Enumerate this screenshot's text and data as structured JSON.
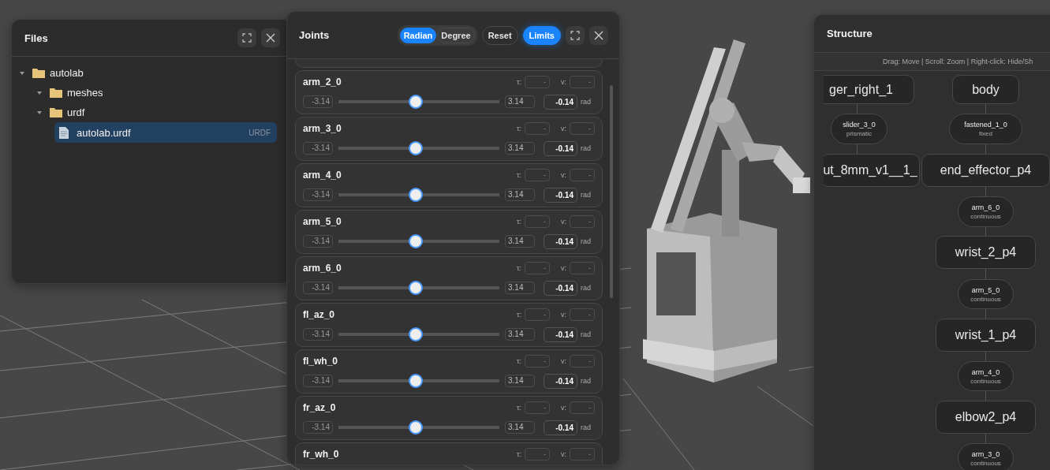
{
  "files_panel": {
    "title": "Files",
    "tree": [
      {
        "name": "autolab",
        "kind": "folder",
        "expanded": true,
        "selected": false,
        "children": [
          {
            "name": "meshes",
            "kind": "folder",
            "expanded": true,
            "selected": false
          },
          {
            "name": "urdf",
            "kind": "folder",
            "expanded": true,
            "selected": false,
            "children": [
              {
                "name": "autolab.urdf",
                "kind": "file",
                "badge": "URDF",
                "selected": true
              }
            ]
          }
        ]
      }
    ]
  },
  "joints_panel": {
    "title": "Joints",
    "units": [
      {
        "label": "Radian",
        "selected": true
      },
      {
        "label": "Degree",
        "selected": false
      }
    ],
    "buttons": [
      {
        "label": "Reset",
        "active": false
      },
      {
        "label": "Limits",
        "active": true
      }
    ],
    "joints": [
      {
        "name": "arm_2_0",
        "tau_label": "τ:",
        "tau": "-",
        "v_label": "v:",
        "v": "-",
        "min": "-3.14",
        "max": "3.14",
        "value": "-0.14",
        "unit": "rad",
        "level": 0.48
      },
      {
        "name": "arm_3_0",
        "tau_label": "τ:",
        "tau": "-",
        "v_label": "v:",
        "v": "-",
        "min": "-3.14",
        "max": "3.14",
        "value": "-0.14",
        "unit": "rad",
        "level": 0.48
      },
      {
        "name": "arm_4_0",
        "tau_label": "τ:",
        "tau": "-",
        "v_label": "v:",
        "v": "-",
        "min": "-3.14",
        "max": "3.14",
        "value": "-0.14",
        "unit": "rad",
        "level": 0.48
      },
      {
        "name": "arm_5_0",
        "tau_label": "τ:",
        "tau": "-",
        "v_label": "v:",
        "v": "-",
        "min": "-3.14",
        "max": "3.14",
        "value": "-0.14",
        "unit": "rad",
        "level": 0.48
      },
      {
        "name": "arm_6_0",
        "tau_label": "τ:",
        "tau": "-",
        "v_label": "v:",
        "v": "-",
        "min": "-3.14",
        "max": "3.14",
        "value": "-0.14",
        "unit": "rad",
        "level": 0.48
      },
      {
        "name": "fl_az_0",
        "tau_label": "τ:",
        "tau": "-",
        "v_label": "v:",
        "v": "-",
        "min": "-3.14",
        "max": "3.14",
        "value": "-0.14",
        "unit": "rad",
        "level": 0.48
      },
      {
        "name": "fl_wh_0",
        "tau_label": "τ:",
        "tau": "-",
        "v_label": "v:",
        "v": "-",
        "min": "-3.14",
        "max": "3.14",
        "value": "-0.14",
        "unit": "rad",
        "level": 0.48
      },
      {
        "name": "fr_az_0",
        "tau_label": "τ:",
        "tau": "-",
        "v_label": "v:",
        "v": "-",
        "min": "-3.14",
        "max": "3.14",
        "value": "-0.14",
        "unit": "rad",
        "level": 0.48
      },
      {
        "name": "fr_wh_0",
        "tau_label": "τ:",
        "tau": "-",
        "v_label": "v:",
        "v": "-"
      }
    ]
  },
  "structure_panel": {
    "title": "Structure",
    "hint": "Drag: Move | Scroll: Zoom | Right-click: Hide/Sh",
    "nodes": [
      {
        "kind": "link",
        "label": "ger_right_1"
      },
      {
        "kind": "link",
        "label": "body"
      },
      {
        "kind": "joint",
        "name": "slider_3_0",
        "type": "prismatic"
      },
      {
        "kind": "joint",
        "name": "fastened_1_0",
        "type": "fixed"
      },
      {
        "kind": "link",
        "label": "ut_8mm_v1__1_"
      },
      {
        "kind": "link",
        "label": "end_effector_p4"
      },
      {
        "kind": "joint",
        "name": "arm_6_0",
        "type": "continuous"
      },
      {
        "kind": "link",
        "label": "wrist_2_p4"
      },
      {
        "kind": "joint",
        "name": "arm_5_0",
        "type": "continuous"
      },
      {
        "kind": "link",
        "label": "wrist_1_p4"
      },
      {
        "kind": "joint",
        "name": "arm_4_0",
        "type": "continuous"
      },
      {
        "kind": "link",
        "label": "elbow2_p4"
      },
      {
        "kind": "joint",
        "name": "arm_3_0",
        "type": "continuous"
      }
    ]
  }
}
